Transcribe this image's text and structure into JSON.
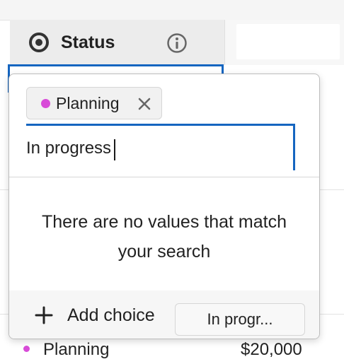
{
  "colors": {
    "accent": "#1565c0",
    "planning_dot": "#d84bd8",
    "header_bg": "#ececec",
    "footer_bg": "#f6f6f6"
  },
  "icons": {
    "status": "circle-target-icon",
    "info": "info-circle-icon",
    "remove_tag": "close-icon",
    "add": "plus-icon"
  },
  "table": {
    "header": {
      "title": "Status"
    },
    "row": {
      "status": "Planning",
      "amount": "$20,000"
    }
  },
  "popover": {
    "selected_tag": {
      "label": "Planning"
    },
    "search": {
      "value": "In progress"
    },
    "empty_message": "There are no values that match your search",
    "footer": {
      "add_label": "Add choice",
      "suggestion": "In progr..."
    }
  }
}
